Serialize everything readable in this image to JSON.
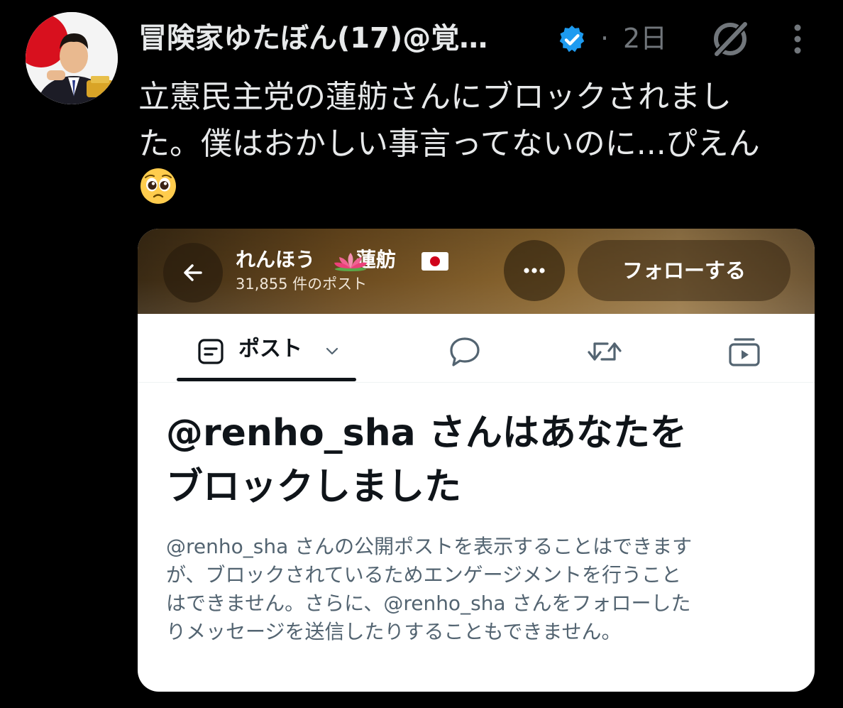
{
  "tweet": {
    "display_name": "冒険家ゆたぼん(17)@覚…",
    "separator": "·",
    "timestamp": "2日",
    "text_lines": [
      "立憲民主党の蓮舫さんにブロックされまし",
      "た。僕はおかしい事言ってないのに...ぴえん"
    ],
    "emoji": "pleading-face-emoji"
  },
  "embedded_profile": {
    "name_prefix": "れんほう",
    "name_suffix": "蓮舫",
    "post_count": "31,855 件のポスト",
    "follow_label": "フォローする",
    "tabs": {
      "posts_label": "ポスト"
    },
    "blocked_title_lines": [
      "@renho_sha さんはあなたを",
      "ブロックしました"
    ],
    "blocked_desc_lines": [
      "@renho_sha さんの公開ポストを表示することはできます",
      "が、ブロックされているためエンゲージメントを行うこと",
      "はできません。さらに、@renho_sha さんをフォローした",
      "りメッセージを送信したりすることもできません。"
    ]
  },
  "colors": {
    "background": "#000000",
    "primary_text": "#e7e9ea",
    "secondary_text": "#71767b",
    "verified_blue": "#1d9bf0",
    "card_title": "#0f1419",
    "card_desc": "#536471"
  }
}
